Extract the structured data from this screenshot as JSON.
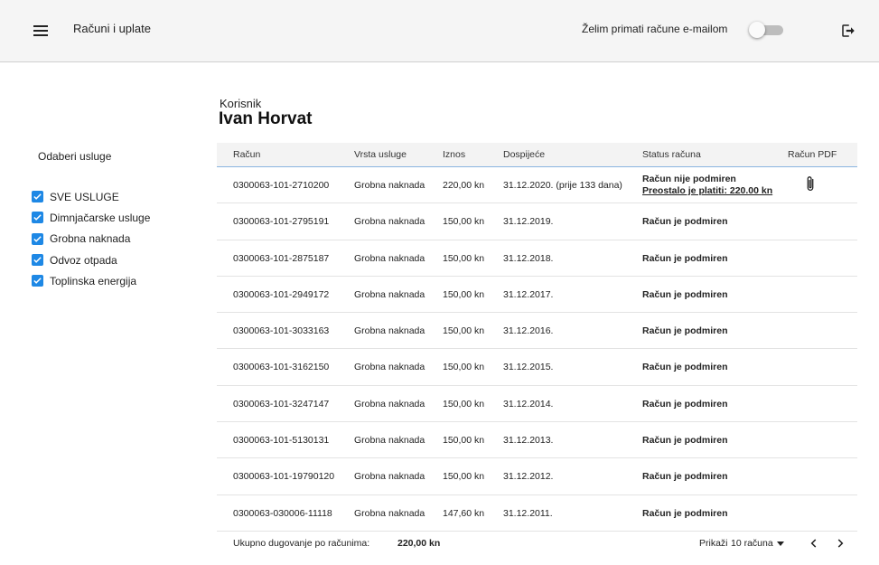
{
  "header": {
    "title": "Računi i uplate",
    "email_toggle_label": "Želim primati račune e-mailom",
    "email_toggle_on": false
  },
  "filters": {
    "title": "Odaberi usluge",
    "items": [
      {
        "label": "SVE USLUGE",
        "checked": true
      },
      {
        "label": "Dimnjačarske usluge",
        "checked": true
      },
      {
        "label": "Grobna naknada",
        "checked": true
      },
      {
        "label": "Odvoz otpada",
        "checked": true
      },
      {
        "label": "Toplinska energija",
        "checked": true
      }
    ]
  },
  "user": {
    "label": "Korisnik",
    "name": "Ivan Horvat"
  },
  "table": {
    "columns": [
      "Račun",
      "Vrsta usluge",
      "Iznos",
      "Dospijeće",
      "Status računa",
      "Račun PDF"
    ],
    "rows": [
      {
        "invoice": "0300063-101-2710200",
        "service": "Grobna naknada",
        "amount": "220,00 kn",
        "due": "31.12.2020. (prije 133 dana)",
        "status": "Račun nije podmiren",
        "remaining": "Preostalo je platiti: 220.00 kn",
        "paid": false,
        "has_pdf": true
      },
      {
        "invoice": "0300063-101-2795191",
        "service": "Grobna naknada",
        "amount": "150,00 kn",
        "due": "31.12.2019.",
        "status": "Račun je podmiren",
        "paid": true
      },
      {
        "invoice": "0300063-101-2875187",
        "service": "Grobna naknada",
        "amount": "150,00 kn",
        "due": "31.12.2018.",
        "status": "Račun je podmiren",
        "paid": true
      },
      {
        "invoice": "0300063-101-2949172",
        "service": "Grobna naknada",
        "amount": "150,00 kn",
        "due": "31.12.2017.",
        "status": "Račun je podmiren",
        "paid": true
      },
      {
        "invoice": "0300063-101-3033163",
        "service": "Grobna naknada",
        "amount": "150,00 kn",
        "due": "31.12.2016.",
        "status": "Račun je podmiren",
        "paid": true
      },
      {
        "invoice": "0300063-101-3162150",
        "service": "Grobna naknada",
        "amount": "150,00 kn",
        "due": "31.12.2015.",
        "status": "Račun je podmiren",
        "paid": true
      },
      {
        "invoice": "0300063-101-3247147",
        "service": "Grobna naknada",
        "amount": "150,00 kn",
        "due": "31.12.2014.",
        "status": "Račun je podmiren",
        "paid": true
      },
      {
        "invoice": "0300063-101-5130131",
        "service": "Grobna naknada",
        "amount": "150,00 kn",
        "due": "31.12.2013.",
        "status": "Račun je podmiren",
        "paid": true
      },
      {
        "invoice": "0300063-101-19790120",
        "service": "Grobna naknada",
        "amount": "150,00 kn",
        "due": "31.12.2012.",
        "status": "Račun je podmiren",
        "paid": true
      },
      {
        "invoice": "0300063-030006-11118",
        "service": "Grobna naknada",
        "amount": "147,60 kn",
        "due": "31.12.2011.",
        "status": "Račun je podmiren",
        "paid": true
      }
    ]
  },
  "footer": {
    "total_label": "Ukupno dugovanje po računima:",
    "total_value": "220,00 kn",
    "show_label": "Prikaži",
    "page_size": "10 računa"
  },
  "colors": {
    "accent": "#1e88e5",
    "paid": "#2db58f",
    "unpaid": "#f0914a"
  },
  "icons": {
    "menu": "menu-icon",
    "logout": "logout-icon",
    "pdf": "paperclip-icon",
    "prev": "chevron-left-icon",
    "next": "chevron-right-icon",
    "dropdown": "caret-down-icon"
  }
}
